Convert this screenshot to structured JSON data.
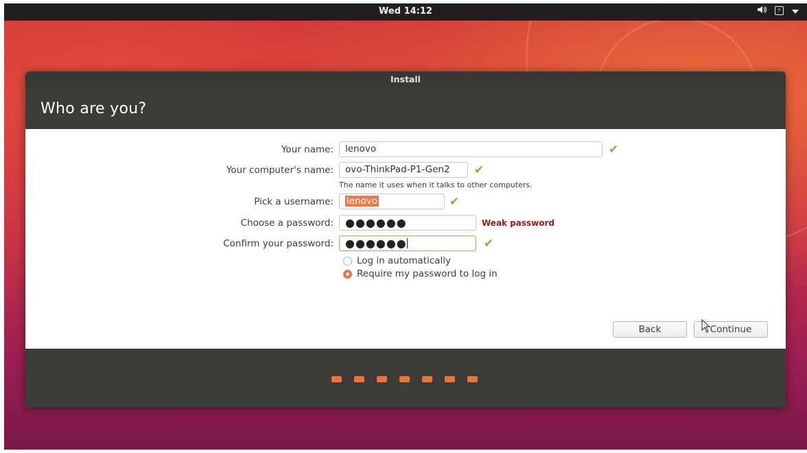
{
  "topbar": {
    "clock": "Wed 14:12",
    "tray_icons": [
      "volume-icon",
      "battery-icon",
      "dropdown-arrow-icon"
    ]
  },
  "window": {
    "title": "Install",
    "heading": "Who are you?"
  },
  "form": {
    "name": {
      "label": "Your name:",
      "value": "lenovo"
    },
    "computer": {
      "label": "Your computer's name:",
      "value": "ovo-ThinkPad-P1-Gen2",
      "hint": "The name it uses when it talks to other computers."
    },
    "username": {
      "label": "Pick a username:",
      "value": "lenovo"
    },
    "password": {
      "label": "Choose a password:",
      "value": "●●●●●●",
      "strength": "Weak password"
    },
    "confirm": {
      "label": "Confirm your password:",
      "value": "●●●●●●"
    },
    "login_options": [
      {
        "label": "Log in automatically",
        "selected": false
      },
      {
        "label": "Require my password to log in",
        "selected": true
      }
    ]
  },
  "buttons": {
    "back": "Back",
    "continue": "Continue"
  },
  "progress": {
    "steps": 7
  },
  "colors": {
    "accent": "#e9753d",
    "check": "#7bb534",
    "warning": "#a31818",
    "dark": "#3c3b37"
  }
}
